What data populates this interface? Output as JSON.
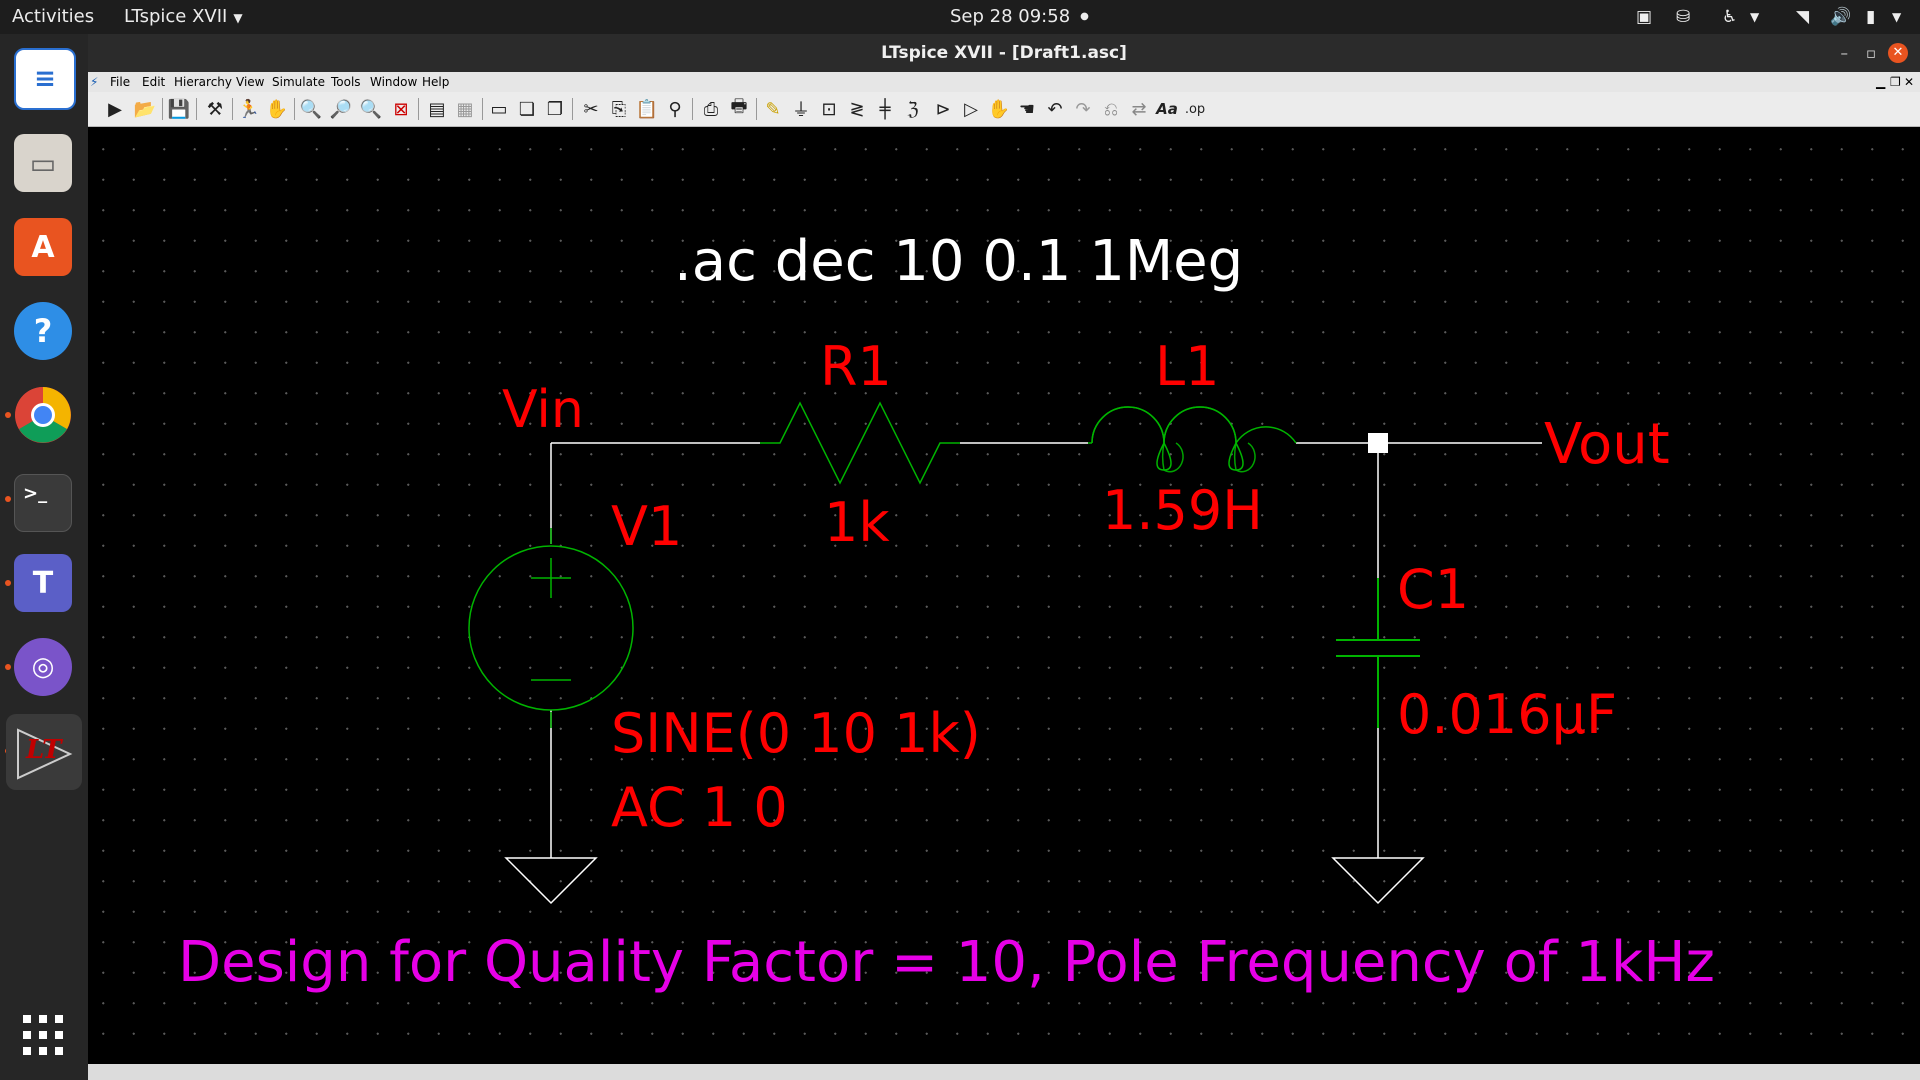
{
  "topbar": {
    "activities": "Activities",
    "app_menu": "LTspice XVII",
    "clock": "Sep 28  09:58"
  },
  "window": {
    "title": "LTspice XVII - [Draft1.asc]"
  },
  "menu": {
    "file": "File",
    "edit": "Edit",
    "hierarchy": "Hierarchy",
    "view": "View",
    "simulate": "Simulate",
    "tools": "Tools",
    "window": "Window",
    "help": "Help"
  },
  "toolbar": {
    "font_label": "Aa",
    "spice_directive_label": ".op"
  },
  "schematic": {
    "directive": ".ac dec 10 0.1 1Meg",
    "nets": {
      "vin": "Vin",
      "vout": "Vout"
    },
    "v1": {
      "name": "V1",
      "value_line1": "SINE(0 10 1k)",
      "value_line2": "AC 1 0"
    },
    "r1": {
      "name": "R1",
      "value": "1k"
    },
    "l1": {
      "name": "L1",
      "value": "1.59H"
    },
    "c1": {
      "name": "C1",
      "value": "0.016µF"
    },
    "comment": "Design for Quality Factor = 10, Pole Frequency of 1kHz",
    "colors": {
      "wire": "#ffffff",
      "component": "#00b400",
      "label": "#ff0000",
      "directive": "#ffffff",
      "comment": "#e600e6"
    }
  }
}
